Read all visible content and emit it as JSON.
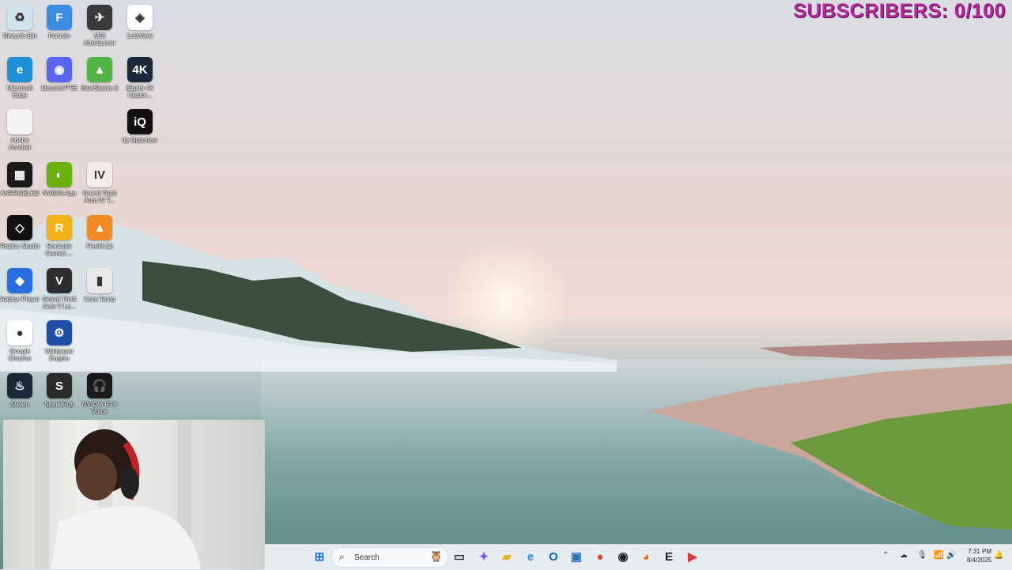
{
  "overlay": {
    "subscribers": "SUBSCRIBERS: 0/100"
  },
  "desktop": {
    "icons": [
      {
        "label": "Recycle Bin",
        "color": "#cfe3ee",
        "glyph": "♻"
      },
      {
        "label": "Fortnite",
        "color": "#3d8be0",
        "glyph": "F"
      },
      {
        "label": "MSI Afterburner",
        "color": "#3a3a3a",
        "glyph": "✈"
      },
      {
        "label": "LetsView",
        "color": "#ffffff",
        "glyph": "◈"
      },
      {
        "label": "Microsoft Edge",
        "color": "#1f8fd8",
        "glyph": "e"
      },
      {
        "label": "Discord PTB",
        "color": "#5865f2",
        "glyph": "◉"
      },
      {
        "label": "BlueStacks 5",
        "color": "#52b347",
        "glyph": "▲"
      },
      {
        "label": "Elgato 4K Captur...",
        "color": "#1a2a3a",
        "glyph": "4K"
      },
      {
        "label": "Adobe Acrobat",
        "color": "#f4f4f4",
        "glyph": ""
      },
      {
        "label": "IQ Optimizer",
        "color": "#111111",
        "glyph": "iQ"
      },
      {
        "label": "ASRRGBLED",
        "color": "#1a1a1a",
        "glyph": "▦"
      },
      {
        "label": "NVIDIA App",
        "color": "#6ab00f",
        "glyph": "◐"
      },
      {
        "label": "Grand Theft Auto IV T...",
        "color": "#f0eee6",
        "glyph": "IV"
      },
      {
        "label": "Roblox Studio",
        "color": "#111111",
        "glyph": "◇"
      },
      {
        "label": "Rockstar Games ...",
        "color": "#f3b318",
        "glyph": "R"
      },
      {
        "label": "FiveM (1)",
        "color": "#f08a24",
        "glyph": "▲"
      },
      {
        "label": "Roblox Player",
        "color": "#2a6fe0",
        "glyph": "◆"
      },
      {
        "label": "Grand Theft Auto V Le...",
        "color": "#2e2e2e",
        "glyph": "V"
      },
      {
        "label": "Core Temp",
        "color": "#e8e8e8",
        "glyph": "▮"
      },
      {
        "label": "Google Chrome",
        "color": "#ffffff",
        "glyph": "●"
      },
      {
        "label": "Wallpaper Engine",
        "color": "#1e4fa8",
        "glyph": "⚙"
      },
      {
        "label": "Steam",
        "color": "#1b2838",
        "glyph": "♨"
      },
      {
        "label": "SignalRgb",
        "color": "#2b2b2b",
        "glyph": "S"
      },
      {
        "label": "NVIDIA RTX Voice",
        "color": "#1a1a1a",
        "glyph": "🎧"
      }
    ]
  },
  "taskbar": {
    "search_placeholder": "Search",
    "apps": [
      "start-icon",
      "search-icon",
      "task-view-icon",
      "copilot-icon",
      "file-explorer-icon",
      "edge-icon",
      "outlook-icon",
      "photos-icon",
      "chrome-icon",
      "obs-icon",
      "firefox-icon",
      "epic-games-icon",
      "streamlabs-icon"
    ],
    "clock_time": "7:31 PM",
    "clock_date": "8/4/2025"
  }
}
